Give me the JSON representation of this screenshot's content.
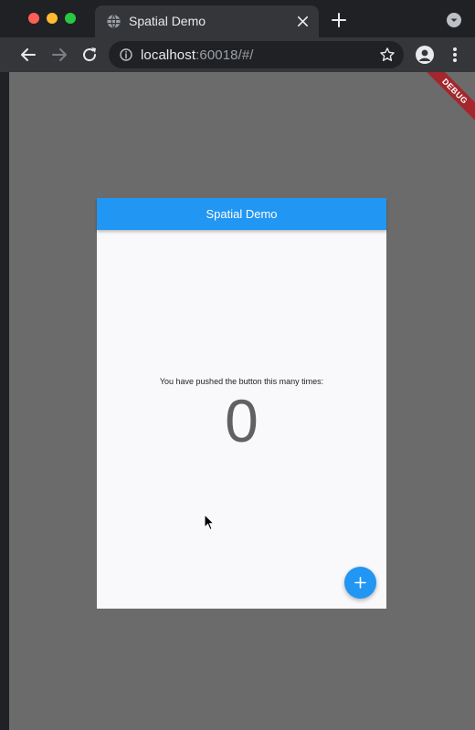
{
  "browser": {
    "tab_title": "Spatial Demo",
    "url_host": "localhost",
    "url_path": ":60018/#/"
  },
  "debug_banner": "DEBUG",
  "app": {
    "title": "Spatial Demo",
    "counter_label": "You have pushed the button this many times:",
    "counter_value": "0",
    "fab_icon": "add-icon"
  },
  "colors": {
    "primary": "#2196f3",
    "debug_banner": "#a3272d",
    "viewport_background": "#6b6b6b"
  }
}
